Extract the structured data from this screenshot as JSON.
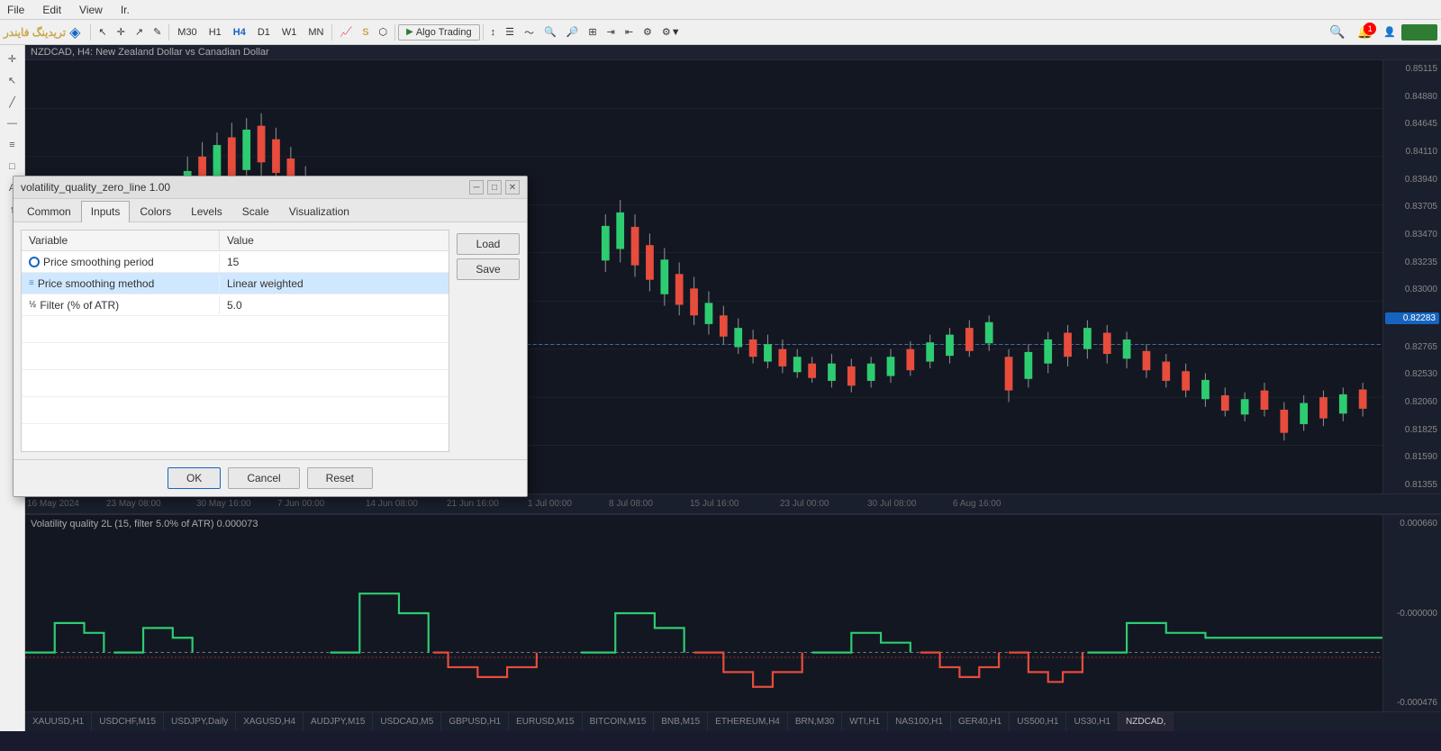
{
  "app": {
    "title": "TradingFinder",
    "logo_text": "تریدینگ فایندر"
  },
  "menubar": {
    "items": [
      "File",
      "Edit",
      "View",
      "Ir."
    ]
  },
  "toolbar": {
    "timeframes": [
      "M30",
      "H1",
      "H4",
      "D1",
      "W1",
      "MN"
    ],
    "active_tf": "H4",
    "algo_trading_label": "Algo Trading",
    "search_placeholder": "Search"
  },
  "chart": {
    "header": "NZDCAD, H4:  New Zealand Dollar vs Canadian Dollar",
    "current_price": "0.82283",
    "price_labels": [
      "0.85115",
      "0.84880",
      "0.84645",
      "0.84110",
      "0.83940",
      "0.83705",
      "0.83470",
      "0.83235",
      "0.83000",
      "0.82765",
      "0.82530",
      "0.82060",
      "0.81825",
      "0.81590",
      "0.81355"
    ],
    "date_labels": [
      "16 May 2024",
      "23 May 08:00",
      "30 May 16:00",
      "7 Jun 00:00",
      "14 Jun 08:00",
      "21 Jun 16:00",
      "1 Jul 00:00",
      "8 Jul 08:00",
      "15 Jul 16:00",
      "23 Jul 00:00",
      "30 Jul 08:00",
      "6 Aug 16:00"
    ],
    "lower_indicator_label": "Volatility quality 2L (15, filter 5.0% of ATR) 0.000073",
    "lower_price_labels": [
      "0.000660",
      "-0.000000",
      "-0.000476"
    ]
  },
  "bottom_tabs": {
    "items": [
      "XAUUSD,H1",
      "USDCHF,M15",
      "USDJPY,Daily",
      "XAGUSD,H4",
      "AUDJPY,M15",
      "USDCAD,M5",
      "GBPUSD,H1",
      "EURUSD,M15",
      "BITCOIN,M15",
      "BNB,M15",
      "ETHEREUM,H4",
      "BRN,M30",
      "WTI,H1",
      "NAS100,H1",
      "GER40,H1",
      "US500,H1",
      "US30,H1",
      "NZDCAD,"
    ]
  },
  "dialog": {
    "title": "volatility_quality_zero_line 1.00",
    "tabs": [
      "Common",
      "Inputs",
      "Colors",
      "Levels",
      "Scale",
      "Visualization"
    ],
    "active_tab": "Inputs",
    "table": {
      "headers": [
        "Variable",
        "Value"
      ],
      "rows": [
        {
          "icon": "circle-outline",
          "variable": "Price smoothing period",
          "value": "15",
          "highlighted": false
        },
        {
          "icon": "lines",
          "variable": "Price smoothing method",
          "value": "Linear weighted",
          "highlighted": true
        },
        {
          "icon": "fraction",
          "variable": "Filter (% of ATR)",
          "value": "5.0",
          "highlighted": false
        }
      ]
    },
    "buttons": {
      "load": "Load",
      "save": "Save",
      "ok": "OK",
      "cancel": "Cancel",
      "reset": "Reset"
    }
  }
}
